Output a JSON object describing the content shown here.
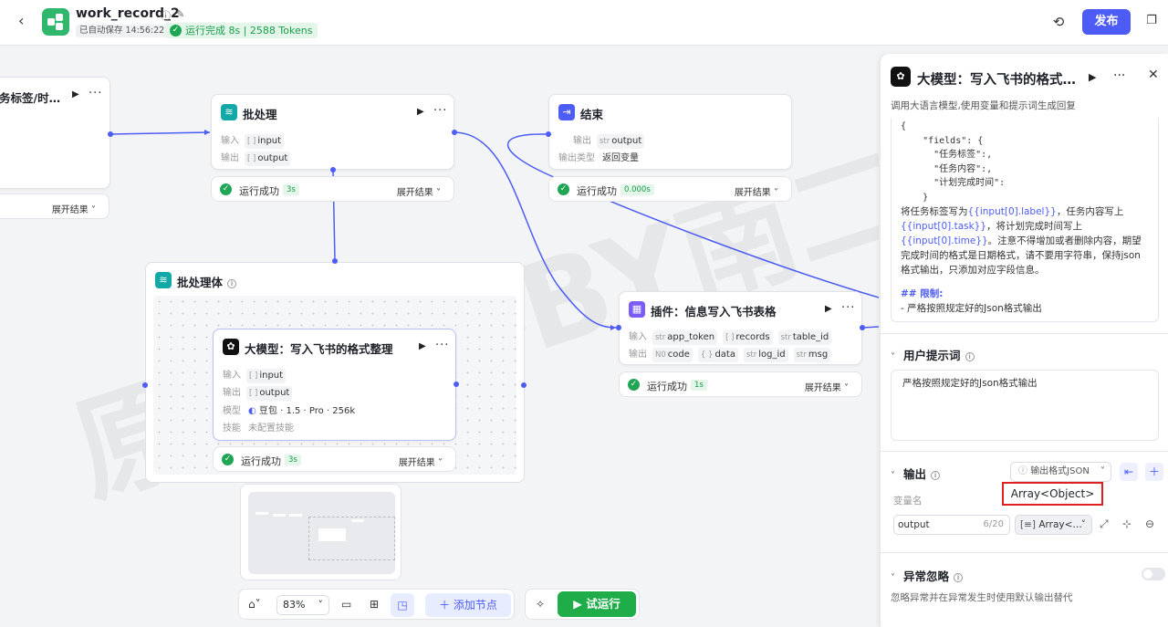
{
  "header": {
    "title": "work_record_2",
    "autosave": "已自动保存 14:56:22",
    "run_status": "运行完成 8s | 2588 Tokens",
    "publish_label": "发布"
  },
  "colors": {
    "accent": "#4c5cf5",
    "success": "#1fa654",
    "highlight": "#e02020"
  },
  "canvas": {
    "watermark": "原创内容BY南二",
    "nodes": {
      "partial": {
        "title": "务标签/时…",
        "expand": "展开结果"
      },
      "batch": {
        "title": "批处理",
        "input_label": "输入",
        "input_var": "input",
        "output_label": "输出",
        "output_var": "output",
        "status": "运行成功",
        "duration": "3s",
        "expand": "展开结果"
      },
      "end": {
        "title": "结束",
        "output_label": "输出",
        "output_var": "output",
        "output_type_label": "输出类型",
        "output_type": "返回变量",
        "status": "运行成功",
        "duration": "0.000s",
        "expand": "展开结果"
      },
      "group": {
        "title": "批处理体"
      },
      "llm": {
        "title": "大模型：写入飞书的格式整理",
        "input_label": "输入",
        "input_var": "input",
        "output_label": "输出",
        "output_var": "output",
        "model_label": "模型",
        "model": "豆包 · 1.5 · Pro · 256k",
        "skill_label": "技能",
        "skill": "未配置技能",
        "status": "运行成功",
        "duration": "3s",
        "expand": "展开结果"
      },
      "plugin": {
        "title": "插件：信息写入飞书表格",
        "input_label": "输入",
        "inputs": [
          "app_token",
          "records",
          "table_id"
        ],
        "output_label": "输出",
        "outputs": [
          "code",
          "data",
          "log_id",
          "msg"
        ],
        "status": "运行成功",
        "duration": "1s",
        "expand": "展开结果"
      }
    }
  },
  "toolbar": {
    "zoom": "83%",
    "add_node": "添加节点",
    "trial_run": "试运行"
  },
  "panel": {
    "title": "大模型：写入飞书的格式…",
    "description": "调用大语言模型,使用变量和提示词生成回复",
    "prompt": {
      "code_lines": [
        "{",
        "    \"fields\": {",
        "      \"任务标签\":,",
        "      \"任务内容\":,",
        "      \"计划完成时间\":",
        "    }"
      ],
      "p1_a": "将任务标签写为",
      "p1_v1": "{{input[0].label}}",
      "p1_b": "，任务内容写上",
      "p1_v2": "{{input[0].task}}",
      "p1_c": "，将计划完成时间写上",
      "p1_v3": "{{input[0].time}}",
      "p1_d": "。注意不得增加或者删除内容，期望完成时间的格式是日期格式，请不要用字符串，保持json格式输出，只添加对应字段信息。",
      "limit_heading": "## 限制:",
      "limit_item": "- 严格按照规定好的Json格式输出"
    },
    "user_prompt": {
      "label": "用户提示词",
      "value": "严格按照规定好的Json格式输出"
    },
    "output": {
      "label": "输出",
      "format": "输出格式JSON",
      "tooltip": "Array<Object>",
      "var_name_label": "变量名",
      "var_name": "output",
      "var_count": "6/20",
      "var_type": "Array<…"
    },
    "exception": {
      "label": "异常忽略",
      "note": "忽略异常并在异常发生时使用默认输出替代"
    }
  }
}
